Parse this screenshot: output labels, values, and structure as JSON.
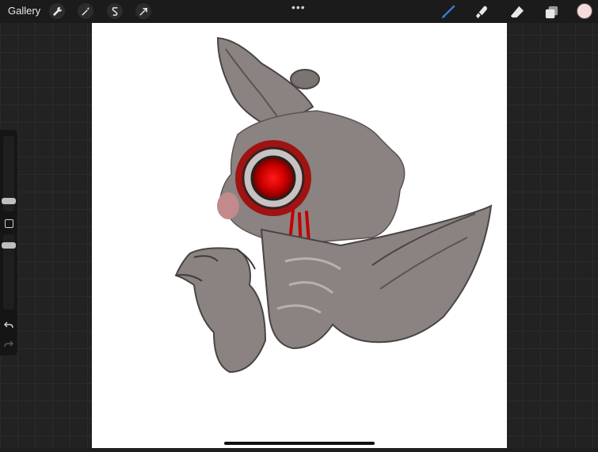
{
  "topbar": {
    "gallery_label": "Gallery",
    "more_dots": "•••",
    "active_color": "#f5dbdb"
  },
  "tools": {
    "left": [
      "settings-wrench",
      "adjustments-magic",
      "selection",
      "transform-arrow"
    ],
    "right": [
      "brush",
      "smudge",
      "eraser",
      "layers"
    ],
    "active_tool_color": "#3b7de8"
  },
  "sidebar": {
    "brush_size_level": 0.33,
    "opacity_level": 0.8
  },
  "canvas": {
    "background": "#ffffff",
    "artwork": "rabbit-sketch"
  }
}
